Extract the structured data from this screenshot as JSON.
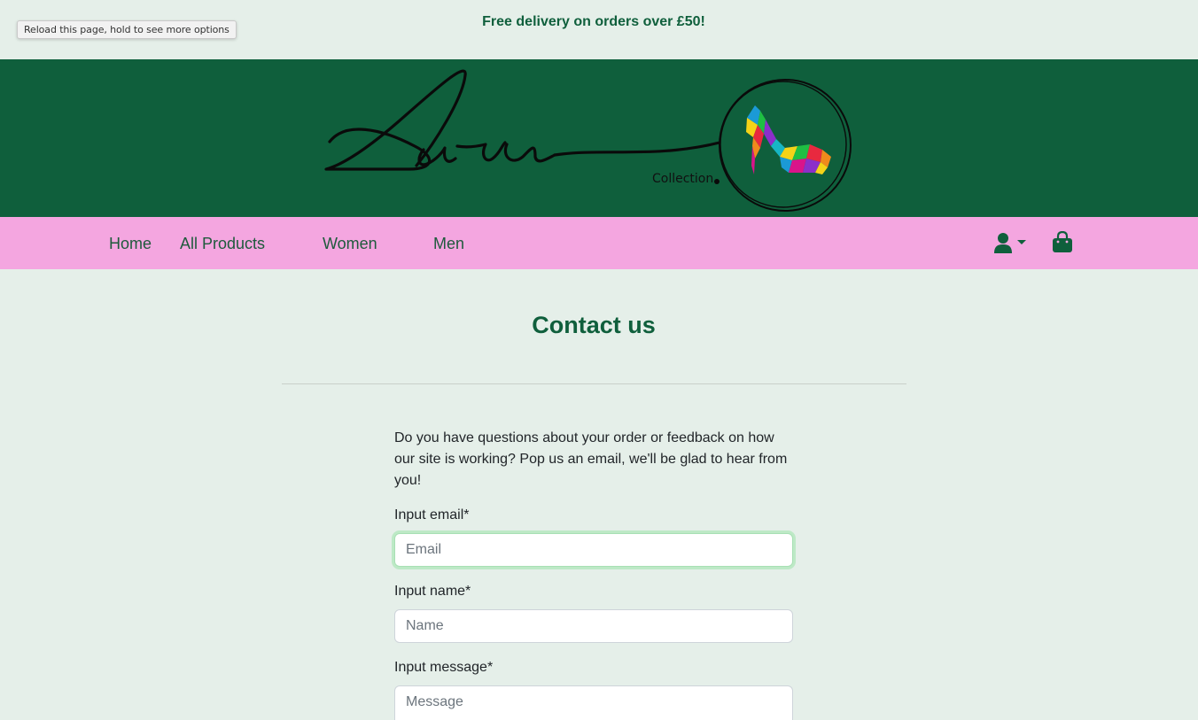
{
  "tooltip": "Reload this page, hold to see more options",
  "banner": {
    "delivery_text": "Free delivery on orders over £50!"
  },
  "logo": {
    "collection_text": "Collection"
  },
  "nav": {
    "links": [
      "Home",
      "All Products",
      "Women",
      "Men"
    ],
    "account_icon": "user-icon",
    "dropdown_icon": "caret-down-icon",
    "bag_icon": "shopping-bag-icon"
  },
  "main": {
    "title": "Contact us",
    "intro": "Do you have questions about your order or feedback on how our site is working? Pop us an email, we'll be glad to hear from you!",
    "fields": {
      "email_label": "Input email*",
      "email_placeholder": "Email",
      "name_label": "Input name*",
      "name_placeholder": "Name",
      "message_label": "Input message*",
      "message_placeholder": "Message"
    }
  },
  "colors": {
    "brand_green": "#0f5f3c",
    "nav_pink": "#f4a6e0",
    "page_background": "#e5efe9",
    "focus_ring": "#bde9c6"
  }
}
